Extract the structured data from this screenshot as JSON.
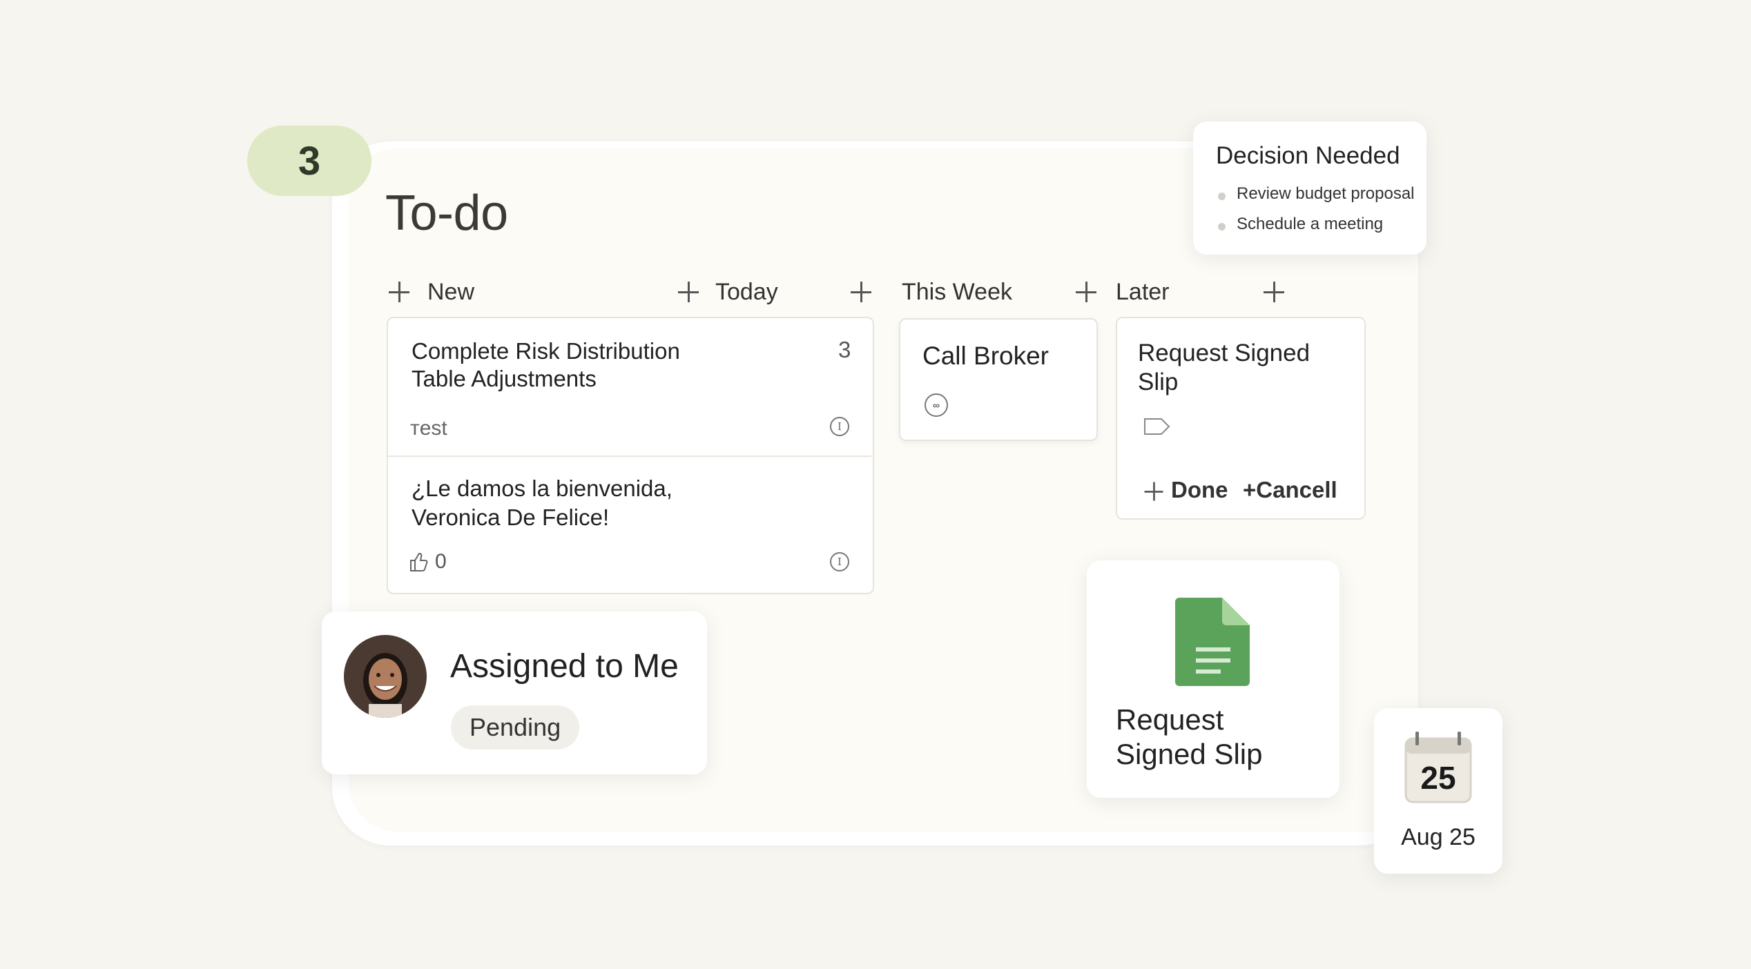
{
  "counter": "3",
  "page_title": "To-do",
  "columns": {
    "new": "New",
    "today": "Today",
    "this_week": "This Week",
    "later": "Later"
  },
  "cards": {
    "risk": {
      "title_line1": "Complete Risk Distribution",
      "title_line2": "Table Adjustments",
      "count": "3",
      "tag": "тest"
    },
    "welcome": {
      "line1": "¿Le damos la bienvenida,",
      "line2": "Veronica De Felice!",
      "likes": "0"
    },
    "broker": {
      "title": "Call Broker"
    },
    "slip": {
      "title_line1": "Request Signed",
      "title_line2": "Slip",
      "done_label": "Done",
      "cancel_label": "+Cancell"
    }
  },
  "decision_popup": {
    "title": "Decision Needed",
    "items": [
      "Review budget proposal",
      "Schedule a meeting"
    ]
  },
  "assigned_popup": {
    "title": "Assigned to Me",
    "status": "Pending"
  },
  "doc_popup": {
    "line1": "Request",
    "line2": "Signed Slip",
    "icon": "green-document-icon"
  },
  "date_popup": {
    "day": "25",
    "label": "Aug 25",
    "icon": "calendar-icon"
  },
  "colors": {
    "pill_bg": "#dfe9c5",
    "doc_green": "#5ba35a",
    "background": "#f6f5f0"
  }
}
